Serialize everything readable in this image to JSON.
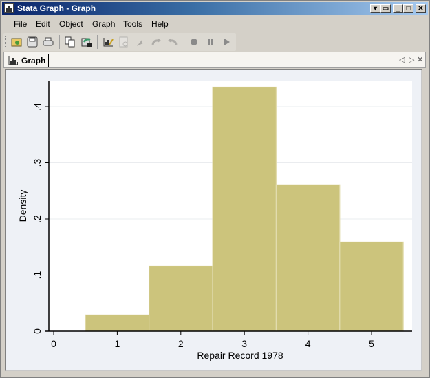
{
  "window": {
    "title": "Stata Graph - Graph",
    "controls": [
      "dropdown-icon",
      "restore-icon",
      "minimize-icon",
      "maximize-icon",
      "close-icon"
    ]
  },
  "menubar": {
    "items": [
      {
        "label": "File",
        "accel": "F"
      },
      {
        "label": "Edit",
        "accel": "E"
      },
      {
        "label": "Object",
        "accel": "O"
      },
      {
        "label": "Graph",
        "accel": "G"
      },
      {
        "label": "Tools",
        "accel": "T"
      },
      {
        "label": "Help",
        "accel": "H"
      }
    ]
  },
  "toolbar": {
    "buttons": [
      {
        "name": "open-graph",
        "icon": "folder-open-icon",
        "enabled": true
      },
      {
        "name": "save-graph",
        "icon": "floppy-disk-icon",
        "enabled": true
      },
      {
        "name": "print-graph",
        "icon": "printer-icon",
        "enabled": true
      },
      {
        "name": "copy-graph",
        "icon": "copy-icon",
        "enabled": true
      },
      {
        "name": "rename-graph",
        "icon": "graph-rename-icon",
        "enabled": true
      },
      {
        "name": "graph-editor",
        "icon": "graph-editor-icon",
        "enabled": true
      },
      {
        "name": "object-browser",
        "icon": "object-browser-icon",
        "enabled": false
      },
      {
        "name": "pointer-tool",
        "icon": "pointer-icon",
        "enabled": false
      },
      {
        "name": "undo",
        "icon": "undo-icon",
        "enabled": false
      },
      {
        "name": "redo",
        "icon": "redo-icon",
        "enabled": false
      },
      {
        "name": "record",
        "icon": "record-icon",
        "enabled": false
      },
      {
        "name": "pause",
        "icon": "pause-icon",
        "enabled": false
      },
      {
        "name": "play",
        "icon": "play-icon",
        "enabled": false
      }
    ]
  },
  "tabs": [
    {
      "label": "Graph",
      "icon": "bar-chart-icon",
      "active": true
    }
  ],
  "tabnav": {
    "prev": "◁",
    "next": "▷",
    "close": "✕"
  },
  "colors": {
    "bar_fill": "#ccc47c",
    "bar_edge": "#e2dcae",
    "plot_bg": "#ffffff",
    "graph_bg": "#eef1f6",
    "gridline": "#eaecef"
  },
  "chart_data": {
    "type": "bar",
    "subtype": "histogram",
    "title": "",
    "xlabel": "Repair Record 1978",
    "ylabel": "Density",
    "categories": [
      "1",
      "2",
      "3",
      "4",
      "5"
    ],
    "bins": [
      {
        "x_from": 0.5,
        "x_to": 1.5,
        "density": 0.029
      },
      {
        "x_from": 1.5,
        "x_to": 2.5,
        "density": 0.116
      },
      {
        "x_from": 2.5,
        "x_to": 3.5,
        "density": 0.435
      },
      {
        "x_from": 3.5,
        "x_to": 4.5,
        "density": 0.261
      },
      {
        "x_from": 4.5,
        "x_to": 5.5,
        "density": 0.159
      }
    ],
    "values": [
      0.029,
      0.116,
      0.435,
      0.261,
      0.159
    ],
    "xlim": [
      -0.1,
      5.6
    ],
    "ylim": [
      0,
      0.445
    ],
    "xticks": [
      0,
      1,
      2,
      3,
      4,
      5
    ],
    "xtick_labels": [
      "0",
      "1",
      "2",
      "3",
      "4",
      "5"
    ],
    "yticks": [
      0,
      0.1,
      0.2,
      0.3,
      0.4
    ],
    "ytick_labels": [
      "0",
      ".1",
      ".2",
      ".3",
      ".4"
    ],
    "grid": "horizontal",
    "legend": "none"
  }
}
